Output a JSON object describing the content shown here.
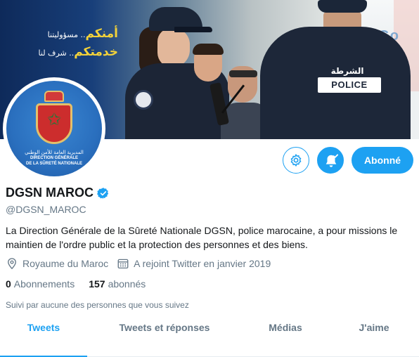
{
  "banner": {
    "slogan_line1_gold": "أمنكم",
    "slogan_line1_white": ".. مسؤوليتنا",
    "slogan_line2_gold": "خدمتكم",
    "slogan_line2_white": ".. شرف لنا",
    "police_patch_arabic": "الشرطة",
    "police_patch": "POLICE",
    "background_sign": "G-Go"
  },
  "avatar": {
    "arabic_text": "المديرية العامة للأمن الوطني",
    "line1": "DIRECTION GÉNÉRALE",
    "line2": "DE LA SÛRETÉ NATIONALE"
  },
  "actions": {
    "settings_icon": "gear-icon",
    "notify_icon": "bell-check-icon",
    "follow_label": "Abonné"
  },
  "profile": {
    "name": "DGSN MAROC",
    "handle": "@DGSN_MAROC",
    "bio": "La Direction Générale de la Sûreté Nationale DGSN, police marocaine, a pour missions le maintien de l'ordre public et la protection des personnes et des biens.",
    "location": "Royaume du Maroc",
    "joined": "A rejoint Twitter en janvier 2019",
    "following_count": "0",
    "following_label": "Abonnements",
    "followers_count": "157",
    "followers_label": "abonnés",
    "followed_by": "Suivi par aucune des personnes que vous suivez"
  },
  "tabs": [
    {
      "label": "Tweets",
      "active": true
    },
    {
      "label": "Tweets et réponses",
      "active": false
    },
    {
      "label": "Médias",
      "active": false
    },
    {
      "label": "J'aime",
      "active": false
    }
  ],
  "colors": {
    "accent": "#1da1f2",
    "text_primary": "#14171a",
    "text_secondary": "#657786"
  }
}
